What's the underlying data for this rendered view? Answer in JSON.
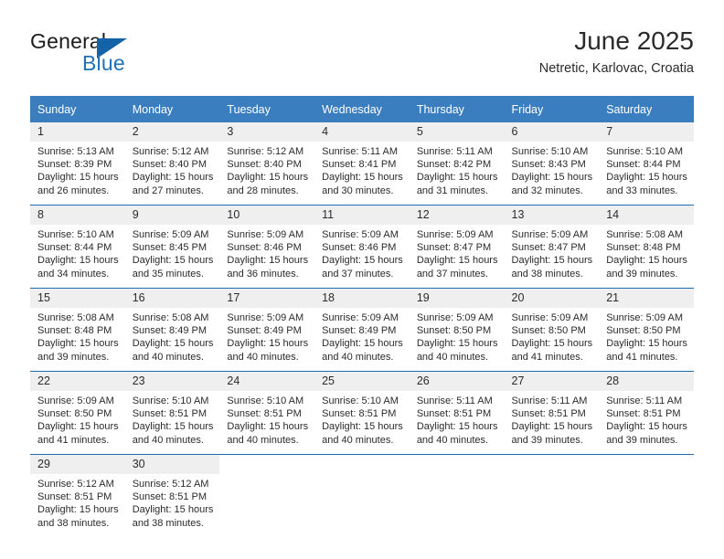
{
  "brand": {
    "name_part1": "General",
    "name_part2": "Blue",
    "triangle_color": "#1462a8",
    "blue_color": "#1f72b8"
  },
  "header": {
    "title": "June 2025",
    "location": "Netretic, Karlovac, Croatia"
  },
  "theme": {
    "header_row_bg": "#3a7ebf",
    "header_row_text": "#ffffff",
    "row_divider": "#1f6cb0",
    "daynum_bg": "#efefef",
    "body_text": "#2b2b2b"
  },
  "weekdays": [
    "Sunday",
    "Monday",
    "Tuesday",
    "Wednesday",
    "Thursday",
    "Friday",
    "Saturday"
  ],
  "labels": {
    "sunrise_prefix": "Sunrise:",
    "sunset_prefix": "Sunset:",
    "daylight_prefix": "Daylight:"
  },
  "weeks": [
    [
      {
        "day": "1",
        "sunrise": "Sunrise: 5:13 AM",
        "sunset": "Sunset: 8:39 PM",
        "daylight": "Daylight: 15 hours and 26 minutes."
      },
      {
        "day": "2",
        "sunrise": "Sunrise: 5:12 AM",
        "sunset": "Sunset: 8:40 PM",
        "daylight": "Daylight: 15 hours and 27 minutes."
      },
      {
        "day": "3",
        "sunrise": "Sunrise: 5:12 AM",
        "sunset": "Sunset: 8:40 PM",
        "daylight": "Daylight: 15 hours and 28 minutes."
      },
      {
        "day": "4",
        "sunrise": "Sunrise: 5:11 AM",
        "sunset": "Sunset: 8:41 PM",
        "daylight": "Daylight: 15 hours and 30 minutes."
      },
      {
        "day": "5",
        "sunrise": "Sunrise: 5:11 AM",
        "sunset": "Sunset: 8:42 PM",
        "daylight": "Daylight: 15 hours and 31 minutes."
      },
      {
        "day": "6",
        "sunrise": "Sunrise: 5:10 AM",
        "sunset": "Sunset: 8:43 PM",
        "daylight": "Daylight: 15 hours and 32 minutes."
      },
      {
        "day": "7",
        "sunrise": "Sunrise: 5:10 AM",
        "sunset": "Sunset: 8:44 PM",
        "daylight": "Daylight: 15 hours and 33 minutes."
      }
    ],
    [
      {
        "day": "8",
        "sunrise": "Sunrise: 5:10 AM",
        "sunset": "Sunset: 8:44 PM",
        "daylight": "Daylight: 15 hours and 34 minutes."
      },
      {
        "day": "9",
        "sunrise": "Sunrise: 5:09 AM",
        "sunset": "Sunset: 8:45 PM",
        "daylight": "Daylight: 15 hours and 35 minutes."
      },
      {
        "day": "10",
        "sunrise": "Sunrise: 5:09 AM",
        "sunset": "Sunset: 8:46 PM",
        "daylight": "Daylight: 15 hours and 36 minutes."
      },
      {
        "day": "11",
        "sunrise": "Sunrise: 5:09 AM",
        "sunset": "Sunset: 8:46 PM",
        "daylight": "Daylight: 15 hours and 37 minutes."
      },
      {
        "day": "12",
        "sunrise": "Sunrise: 5:09 AM",
        "sunset": "Sunset: 8:47 PM",
        "daylight": "Daylight: 15 hours and 37 minutes."
      },
      {
        "day": "13",
        "sunrise": "Sunrise: 5:09 AM",
        "sunset": "Sunset: 8:47 PM",
        "daylight": "Daylight: 15 hours and 38 minutes."
      },
      {
        "day": "14",
        "sunrise": "Sunrise: 5:08 AM",
        "sunset": "Sunset: 8:48 PM",
        "daylight": "Daylight: 15 hours and 39 minutes."
      }
    ],
    [
      {
        "day": "15",
        "sunrise": "Sunrise: 5:08 AM",
        "sunset": "Sunset: 8:48 PM",
        "daylight": "Daylight: 15 hours and 39 minutes."
      },
      {
        "day": "16",
        "sunrise": "Sunrise: 5:08 AM",
        "sunset": "Sunset: 8:49 PM",
        "daylight": "Daylight: 15 hours and 40 minutes."
      },
      {
        "day": "17",
        "sunrise": "Sunrise: 5:09 AM",
        "sunset": "Sunset: 8:49 PM",
        "daylight": "Daylight: 15 hours and 40 minutes."
      },
      {
        "day": "18",
        "sunrise": "Sunrise: 5:09 AM",
        "sunset": "Sunset: 8:49 PM",
        "daylight": "Daylight: 15 hours and 40 minutes."
      },
      {
        "day": "19",
        "sunrise": "Sunrise: 5:09 AM",
        "sunset": "Sunset: 8:50 PM",
        "daylight": "Daylight: 15 hours and 40 minutes."
      },
      {
        "day": "20",
        "sunrise": "Sunrise: 5:09 AM",
        "sunset": "Sunset: 8:50 PM",
        "daylight": "Daylight: 15 hours and 41 minutes."
      },
      {
        "day": "21",
        "sunrise": "Sunrise: 5:09 AM",
        "sunset": "Sunset: 8:50 PM",
        "daylight": "Daylight: 15 hours and 41 minutes."
      }
    ],
    [
      {
        "day": "22",
        "sunrise": "Sunrise: 5:09 AM",
        "sunset": "Sunset: 8:50 PM",
        "daylight": "Daylight: 15 hours and 41 minutes."
      },
      {
        "day": "23",
        "sunrise": "Sunrise: 5:10 AM",
        "sunset": "Sunset: 8:51 PM",
        "daylight": "Daylight: 15 hours and 40 minutes."
      },
      {
        "day": "24",
        "sunrise": "Sunrise: 5:10 AM",
        "sunset": "Sunset: 8:51 PM",
        "daylight": "Daylight: 15 hours and 40 minutes."
      },
      {
        "day": "25",
        "sunrise": "Sunrise: 5:10 AM",
        "sunset": "Sunset: 8:51 PM",
        "daylight": "Daylight: 15 hours and 40 minutes."
      },
      {
        "day": "26",
        "sunrise": "Sunrise: 5:11 AM",
        "sunset": "Sunset: 8:51 PM",
        "daylight": "Daylight: 15 hours and 40 minutes."
      },
      {
        "day": "27",
        "sunrise": "Sunrise: 5:11 AM",
        "sunset": "Sunset: 8:51 PM",
        "daylight": "Daylight: 15 hours and 39 minutes."
      },
      {
        "day": "28",
        "sunrise": "Sunrise: 5:11 AM",
        "sunset": "Sunset: 8:51 PM",
        "daylight": "Daylight: 15 hours and 39 minutes."
      }
    ],
    [
      {
        "day": "29",
        "sunrise": "Sunrise: 5:12 AM",
        "sunset": "Sunset: 8:51 PM",
        "daylight": "Daylight: 15 hours and 38 minutes."
      },
      {
        "day": "30",
        "sunrise": "Sunrise: 5:12 AM",
        "sunset": "Sunset: 8:51 PM",
        "daylight": "Daylight: 15 hours and 38 minutes."
      },
      {
        "day": "",
        "sunrise": "",
        "sunset": "",
        "daylight": ""
      },
      {
        "day": "",
        "sunrise": "",
        "sunset": "",
        "daylight": ""
      },
      {
        "day": "",
        "sunrise": "",
        "sunset": "",
        "daylight": ""
      },
      {
        "day": "",
        "sunrise": "",
        "sunset": "",
        "daylight": ""
      },
      {
        "day": "",
        "sunrise": "",
        "sunset": "",
        "daylight": ""
      }
    ]
  ]
}
